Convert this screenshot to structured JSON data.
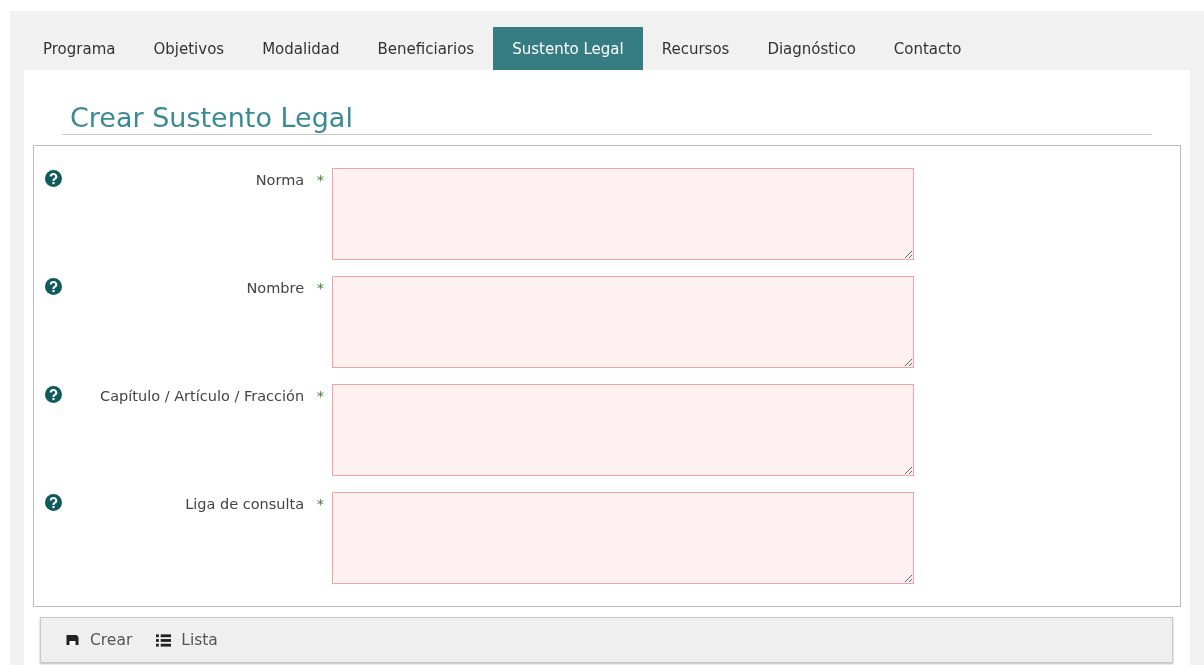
{
  "tabs": [
    {
      "label": "Programa",
      "selected": false
    },
    {
      "label": "Objetivos",
      "selected": false
    },
    {
      "label": "Modalidad",
      "selected": false
    },
    {
      "label": "Beneficiarios",
      "selected": false
    },
    {
      "label": "Sustento Legal",
      "selected": true
    },
    {
      "label": "Recursos",
      "selected": false
    },
    {
      "label": "Diagnóstico",
      "selected": false
    },
    {
      "label": "Contacto",
      "selected": false
    }
  ],
  "form_title": "Crear Sustento Legal",
  "fields": [
    {
      "label": "Norma",
      "required_mark": "*",
      "invalid": true
    },
    {
      "label": "Nombre",
      "required_mark": "*",
      "invalid": true
    },
    {
      "label": "Capítulo / Artículo / Fracción",
      "required_mark": "*",
      "invalid": true
    },
    {
      "label": "Liga de consulta",
      "required_mark": "*",
      "invalid": true
    }
  ],
  "actions": [
    {
      "kind": "save",
      "label": "Crear"
    },
    {
      "kind": "list",
      "label": "Lista"
    }
  ]
}
